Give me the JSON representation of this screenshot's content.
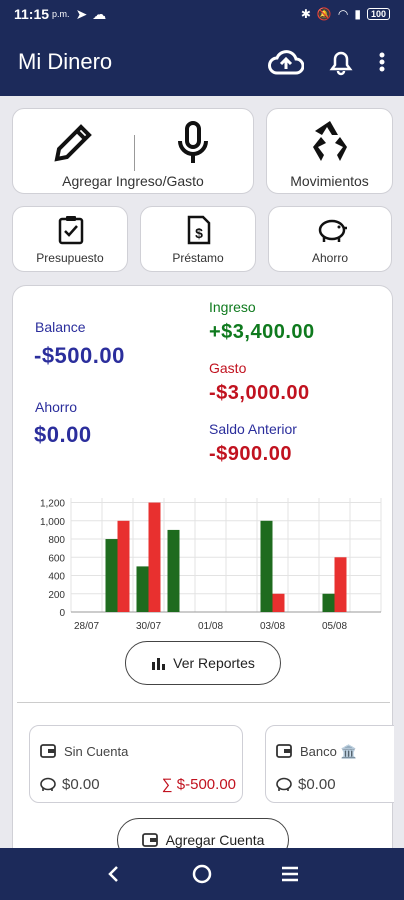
{
  "status": {
    "time": "11:15",
    "ampm": "p.m.",
    "battery": "100"
  },
  "app": {
    "title": "Mi Dinero"
  },
  "actions": {
    "add_label": "Agregar Ingreso/Gasto",
    "movements_label": "Movimientos",
    "budget_label": "Presupuesto",
    "loan_label": "Préstamo",
    "savings_label": "Ahorro"
  },
  "summary": {
    "balance_label": "Balance",
    "balance_value": "-$500.00",
    "savings_label": "Ahorro",
    "savings_value": "$0.00",
    "income_label": "Ingreso",
    "income_value": "+$3,400.00",
    "expense_label": "Gasto",
    "expense_value": "-$3,000.00",
    "previous_label": "Saldo Anterior",
    "previous_value": "-$900.00"
  },
  "chart_data": {
    "type": "bar",
    "categories": [
      "28/07",
      "29/07",
      "30/07",
      "31/07",
      "01/08",
      "02/08",
      "03/08",
      "04/08",
      "05/08",
      "06/08"
    ],
    "tick_labels": [
      "28/07",
      "30/07",
      "01/08",
      "03/08",
      "05/08"
    ],
    "series": [
      {
        "color": "#1e6b1e",
        "values": [
          0,
          800,
          500,
          900,
          0,
          0,
          1000,
          0,
          200,
          0
        ]
      },
      {
        "color": "#e8302f",
        "values": [
          0,
          1000,
          1200,
          0,
          0,
          0,
          200,
          0,
          600,
          0
        ]
      }
    ],
    "y_ticks": [
      "0",
      "200",
      "400",
      "600",
      "800",
      "1,000",
      "1,200"
    ],
    "ylim": [
      0,
      1250
    ],
    "grid": true
  },
  "reports_label": "Ver Reportes",
  "accounts": [
    {
      "name": "Sin Cuenta",
      "savings": "$0.00",
      "total": "∑ $-500.00"
    },
    {
      "name": "Banco 🏛️",
      "savings": "$0.00"
    }
  ],
  "add_account_label": "Agregar Cuenta"
}
